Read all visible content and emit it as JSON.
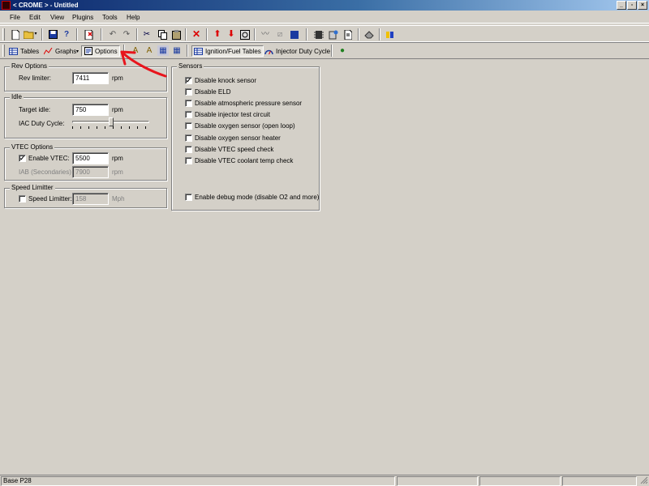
{
  "window": {
    "title": "< CROME > - Untitled",
    "minimize": "_",
    "restore": "▫",
    "close": "×"
  },
  "menu": [
    "File",
    "Edit",
    "View",
    "Plugins",
    "Tools",
    "Help"
  ],
  "toolbar2": {
    "tables": "Tables",
    "graphs": "Graphs",
    "graphs_dropdown": "▾",
    "options": "Options",
    "ignition_fuel": "Ignition/Fuel Tables",
    "injector_duty": "Injector Duty Cycle"
  },
  "rev_options": {
    "legend": "Rev Options",
    "label": "Rev limiter:",
    "value": "7411",
    "unit": "rpm"
  },
  "idle": {
    "legend": "Idle",
    "target_label": "Target idle:",
    "target_value": "750",
    "target_unit": "rpm",
    "iac_label": "IAC Duty Cycle:",
    "iac_level": 0.5
  },
  "vtec": {
    "legend": "VTEC Options",
    "enable_label": "Enable VTEC:",
    "enable_checked": true,
    "enable_value": "5500",
    "enable_unit": "rpm",
    "iab_label": "IAB (Secondaries)",
    "iab_value": "7900",
    "iab_unit": "rpm"
  },
  "speed": {
    "legend": "Speed Limitter",
    "label": "Speed Limitter:",
    "checked": false,
    "value": "158",
    "unit": "Mph"
  },
  "sensors": {
    "legend": "Sensors",
    "items": [
      {
        "label": "Disable knock sensor",
        "checked": true
      },
      {
        "label": "Disable ELD",
        "checked": false
      },
      {
        "label": "Disable atmospheric pressure sensor",
        "checked": false
      },
      {
        "label": "Disable injector test circuit",
        "checked": false
      },
      {
        "label": "Disable oxygen sensor (open loop)",
        "checked": false
      },
      {
        "label": "Disable oxygen sensor heater",
        "checked": false
      },
      {
        "label": "Disable VTEC speed check",
        "checked": false
      },
      {
        "label": "Disable VTEC coolant temp check",
        "checked": false
      }
    ],
    "debug": {
      "label": "Enable debug mode (disable O2 and more)",
      "checked": false
    }
  },
  "status": {
    "left": "Base P28"
  },
  "colors": {
    "title_start": "#0a246a",
    "title_end": "#a6caf0",
    "face": "#d4d0c8",
    "annotation": "#e8141c"
  },
  "icons": {
    "new": "new-file-icon",
    "open": "open-folder-icon",
    "save": "save-icon",
    "help": "help-icon",
    "undo": "undo-icon",
    "redo": "redo-icon",
    "cut": "cut-icon",
    "copy": "copy-icon",
    "paste": "paste-icon",
    "delete": "delete-icon",
    "up": "arrow-up-icon",
    "down": "arrow-down-icon"
  }
}
